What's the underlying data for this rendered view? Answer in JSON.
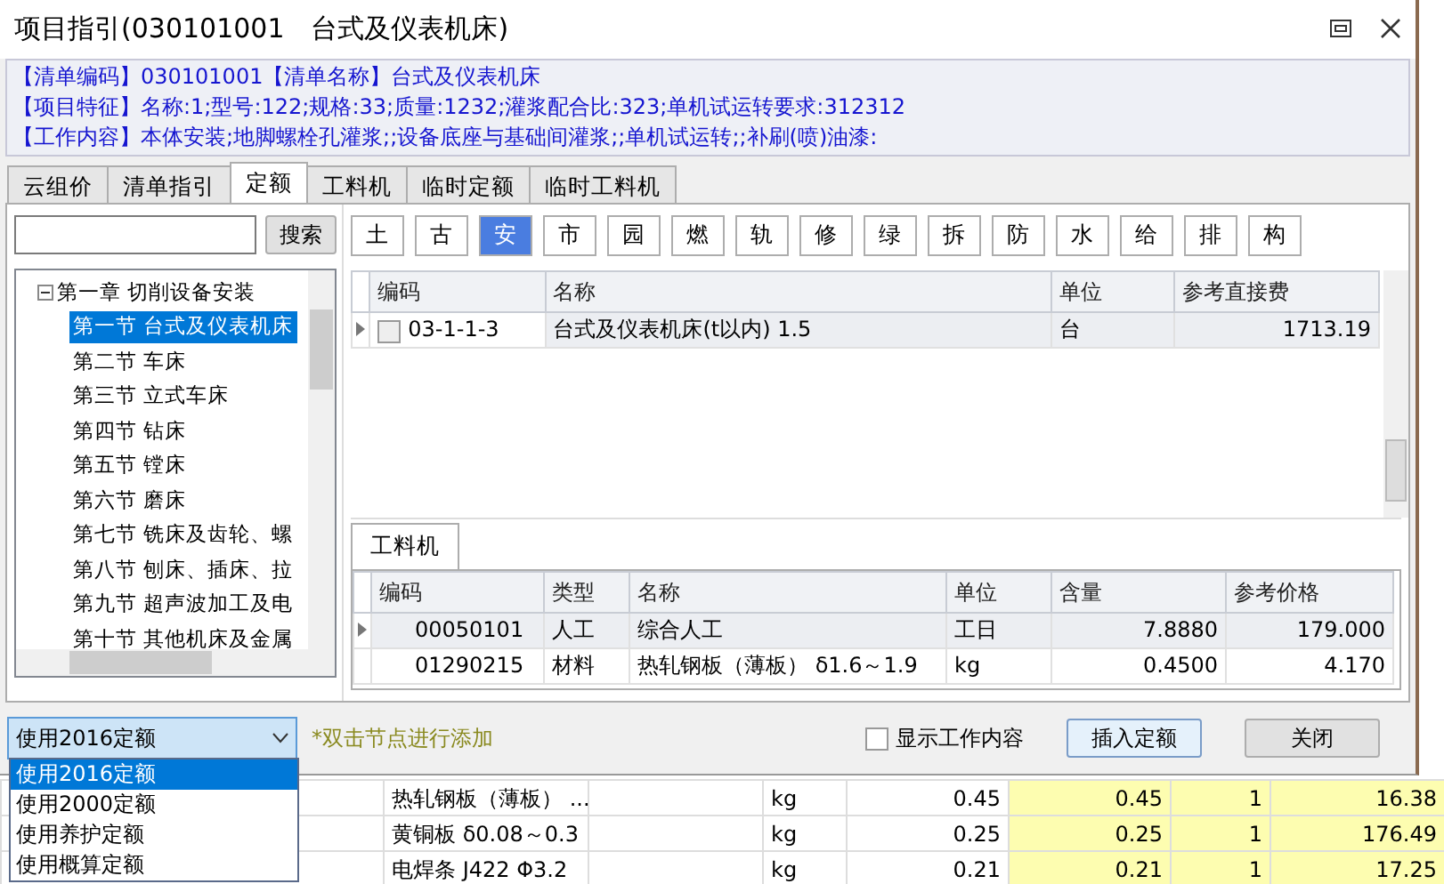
{
  "window": {
    "title": "项目指引(030101001　台式及仪表机床)"
  },
  "info_lines": [
    {
      "label": "【清单编码】",
      "value": "030101001"
    },
    {
      "label": "【清单名称】",
      "value": "台式及仪表机床"
    },
    {
      "label": "【项目特征】",
      "value": "名称:1;型号:122;规格:33;质量:1232;灌浆配合比:323;单机试运转要求:312312"
    },
    {
      "label": "【工作内容】",
      "value": "本体安装;地脚螺栓孔灌浆;;设备底座与基础间灌浆;;单机试运转;;补刷(喷)油漆:"
    }
  ],
  "tabs": [
    {
      "label": "云组价",
      "selected": false
    },
    {
      "label": "清单指引",
      "selected": false
    },
    {
      "label": "定额",
      "selected": true
    },
    {
      "label": "工料机",
      "selected": false
    },
    {
      "label": "临时定额",
      "selected": false
    },
    {
      "label": "临时工料机",
      "selected": false
    }
  ],
  "search_button": "搜索",
  "filters": [
    {
      "label": "土",
      "selected": false
    },
    {
      "label": "古",
      "selected": false
    },
    {
      "label": "安",
      "selected": true
    },
    {
      "label": "市",
      "selected": false
    },
    {
      "label": "园",
      "selected": false
    },
    {
      "label": "燃",
      "selected": false
    },
    {
      "label": "轨",
      "selected": false
    },
    {
      "label": "修",
      "selected": false
    },
    {
      "label": "绿",
      "selected": false
    },
    {
      "label": "拆",
      "selected": false
    },
    {
      "label": "防",
      "selected": false
    },
    {
      "label": "水",
      "selected": false
    },
    {
      "label": "给",
      "selected": false
    },
    {
      "label": "排",
      "selected": false
    },
    {
      "label": "构",
      "selected": false
    }
  ],
  "tree": {
    "label": "第一章 切削设备安装",
    "expanded": true,
    "children": [
      {
        "label": "第一节 台式及仪表机床",
        "selected": true
      },
      {
        "label": "第二节 车床",
        "selected": false
      },
      {
        "label": "第三节 立式车床",
        "selected": false
      },
      {
        "label": "第四节 钻床",
        "selected": false
      },
      {
        "label": "第五节 镗床",
        "selected": false
      },
      {
        "label": "第六节 磨床",
        "selected": false
      },
      {
        "label": "第七节 铣床及齿轮、螺",
        "selected": false
      },
      {
        "label": "第八节 刨床、插床、拉",
        "selected": false
      },
      {
        "label": "第九节 超声波加工及电",
        "selected": false
      },
      {
        "label": "第十节 其他机床及金属",
        "selected": false
      }
    ]
  },
  "quota_table": {
    "columns": [
      "编码",
      "名称",
      "单位",
      "参考直接费"
    ],
    "rows": [
      {
        "checked": false,
        "cells": [
          "03-1-1-3",
          "台式及仪表机床(t以内) 1.5",
          "台",
          "1713.19"
        ]
      }
    ]
  },
  "lower_tabs": [
    {
      "label": "工料机",
      "selected": true
    }
  ],
  "resource_table": {
    "columns": [
      "编码",
      "类型",
      "名称",
      "单位",
      "含量",
      "参考价格"
    ],
    "rows": [
      [
        "00050101",
        "人工",
        "综合人工",
        "工日",
        "7.8880",
        "179.000"
      ],
      [
        "01290215",
        "材料",
        "热轧钢板（薄板） δ1.6～1.9",
        "kg",
        "0.4500",
        "4.170"
      ]
    ]
  },
  "footer": {
    "combo": {
      "value": "使用2016定额",
      "expanded": true,
      "options": [
        {
          "label": "使用2016定额",
          "selected": true
        },
        {
          "label": "使用2000定额",
          "selected": false
        },
        {
          "label": "使用养护定额",
          "selected": false
        },
        {
          "label": "使用概算定额",
          "selected": false
        }
      ]
    },
    "hint": "*双击节点进行添加",
    "show_work": {
      "label": "显示工作内容",
      "checked": false
    },
    "buttons": [
      "插入定额",
      "关闭"
    ]
  },
  "background_rows": [
    [
      "热轧钢板（薄板） ...",
      "kg",
      "0.45",
      "0.45",
      "1",
      "16.38"
    ],
    [
      "黄铜板 δ0.08～0.3",
      "kg",
      "0.25",
      "0.25",
      "1",
      "176.49"
    ],
    [
      "电焊条 J422 Φ3.2",
      "kg",
      "0.21",
      "0.21",
      "1",
      "17.25"
    ]
  ]
}
